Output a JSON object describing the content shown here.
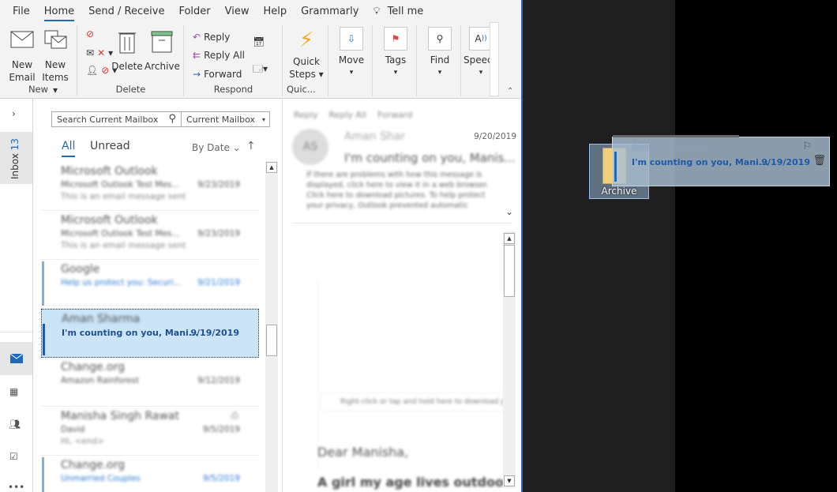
{
  "tabs": [
    "File",
    "Home",
    "Send / Receive",
    "Folder",
    "View",
    "Help",
    "Grammarly",
    "Tell me"
  ],
  "ribbon": {
    "new": {
      "label": "New",
      "new_email": [
        "New",
        "Email"
      ],
      "new_items": [
        "New",
        "Items"
      ]
    },
    "delete": {
      "label": "Delete",
      "delete": "Delete",
      "archive": "Archive"
    },
    "respond": {
      "label": "Respond",
      "reply": "Reply",
      "reply_all": "Reply All",
      "forward": "Forward"
    },
    "quick": {
      "label": "Quic...",
      "quick_steps": [
        "Quick",
        "Steps"
      ]
    },
    "move": "Move",
    "tags": "Tags",
    "find": "Find",
    "speech": "Speech"
  },
  "folder_tab": {
    "label": "Inbox",
    "count": "13"
  },
  "search": {
    "placeholder": "Search Current Mailbox",
    "scope": "Current Mailbox"
  },
  "filters": {
    "all": "All",
    "unread": "Unread",
    "sort": "By Date"
  },
  "emails": [
    {
      "from": "Microsoft Outlook",
      "subject": "Microsoft Outlook Test Mes...",
      "date": "9/23/2019",
      "preview": "This is an email message sent"
    },
    {
      "from": "Microsoft Outlook",
      "subject": "Microsoft Outlook Test Mes...",
      "date": "9/23/2019",
      "preview": "This is an email message sent"
    },
    {
      "from": "Google",
      "subject": "Help us protect you: Securi...",
      "date": "9/21/2019",
      "preview": ""
    },
    {
      "from": "Aman Sharma",
      "subject": "I'm counting on you, Mani...",
      "date": "9/19/2019",
      "preview": ""
    },
    {
      "from": "Change.org",
      "subject": "Amazon Rainforest",
      "date": "9/12/2019",
      "preview": ""
    },
    {
      "from": "Manisha Singh Rawat",
      "subject": "David",
      "date": "9/5/2019",
      "preview": "Hi, <end>"
    },
    {
      "from": "Change.org",
      "subject": "Unmarried Couples",
      "date": "9/5/2019",
      "preview": ""
    }
  ],
  "reading": {
    "actions": [
      "Reply",
      "Reply All",
      "Forward"
    ],
    "initials": "AS",
    "sender": "Aman Shar",
    "date": "9/20/2019",
    "subject": "I'm counting on you, Manis...",
    "info": "If there are problems with how this message is displayed, click here to view it in a web browser. Click here to download pictures. To help protect your privacy, Outlook prevented automatic",
    "image_note": "Right-click or tap and hold here to download pictures.",
    "greeting": "Dear Manisha,",
    "body": "A girl my age lives outdoors worki"
  },
  "drag": {
    "from": "Aman Sharma",
    "subject": "I'm counting on you, Mani...",
    "date": "9/19/2019",
    "target": "Archive"
  }
}
